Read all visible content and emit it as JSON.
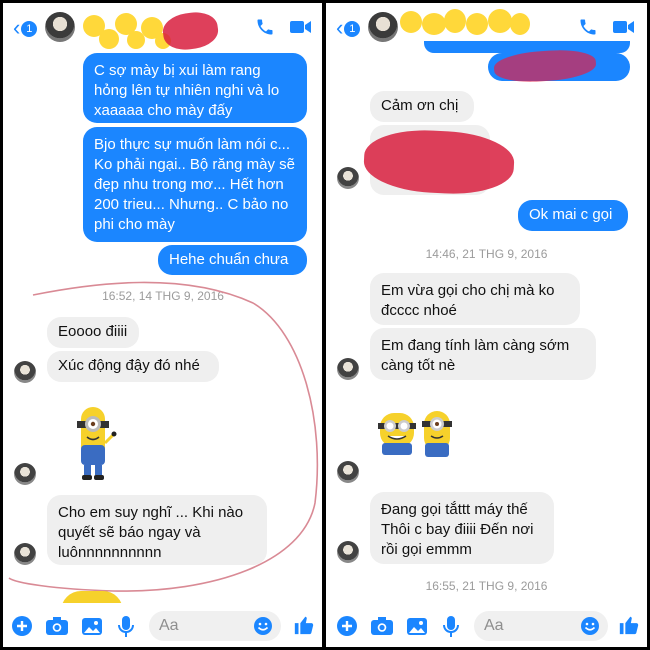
{
  "left": {
    "header": {
      "back_badge": "1"
    },
    "messages": [
      {
        "id": "l1",
        "text": "C sợ mày bị xui làm rang hỏng lên tự nhiên nghi và lo xaaaaa cho mày đấy"
      },
      {
        "id": "l2",
        "text": "Bjo thực sự muốn làm nói c... Ko phải ngại.. Bộ răng mày sẽ đẹp nhu trong mơ... Hết hơn 200 trieu... Nhưng.. C bảo no phi cho mày"
      },
      {
        "id": "l3",
        "text": "Hehe chuẩn chưa"
      },
      {
        "id": "l4",
        "text": "Eoooo điiii"
      },
      {
        "id": "l5",
        "text": "Xúc động đậy đó nhé"
      },
      {
        "id": "l6",
        "text": "Cho em suy nghĩ ... Khi nào quyết sẽ báo ngay và luônnnnnnnnnn"
      }
    ],
    "timestamp": "16:52, 14 THG 9, 2016",
    "composer": {
      "placeholder": "Aa"
    }
  },
  "right": {
    "messages": [
      {
        "id": "r1",
        "text": "Cảm ơn chị"
      },
      {
        "id": "r2",
        "text": "Ok mai c gọi"
      },
      {
        "id": "r3",
        "text": "Em vừa gọi cho chị mà ko đcccc nhoé"
      },
      {
        "id": "r4",
        "text": "Em đang tính làm càng sớm càng tốt nè"
      },
      {
        "id": "r5",
        "text": "Đang gọi tắttt máy thế Thôi c bay điiii Đến nơi rồi gọi emmm"
      }
    ],
    "timestamps": [
      "14:46, 21 THG 9, 2016",
      "16:55, 21 THG 9, 2016"
    ],
    "composer": {
      "placeholder": "Aa"
    }
  },
  "colors": {
    "accent": "#1b86ff",
    "incoming": "#efefef",
    "redact": "#d81f3e",
    "sticker": "#ffd83a"
  }
}
